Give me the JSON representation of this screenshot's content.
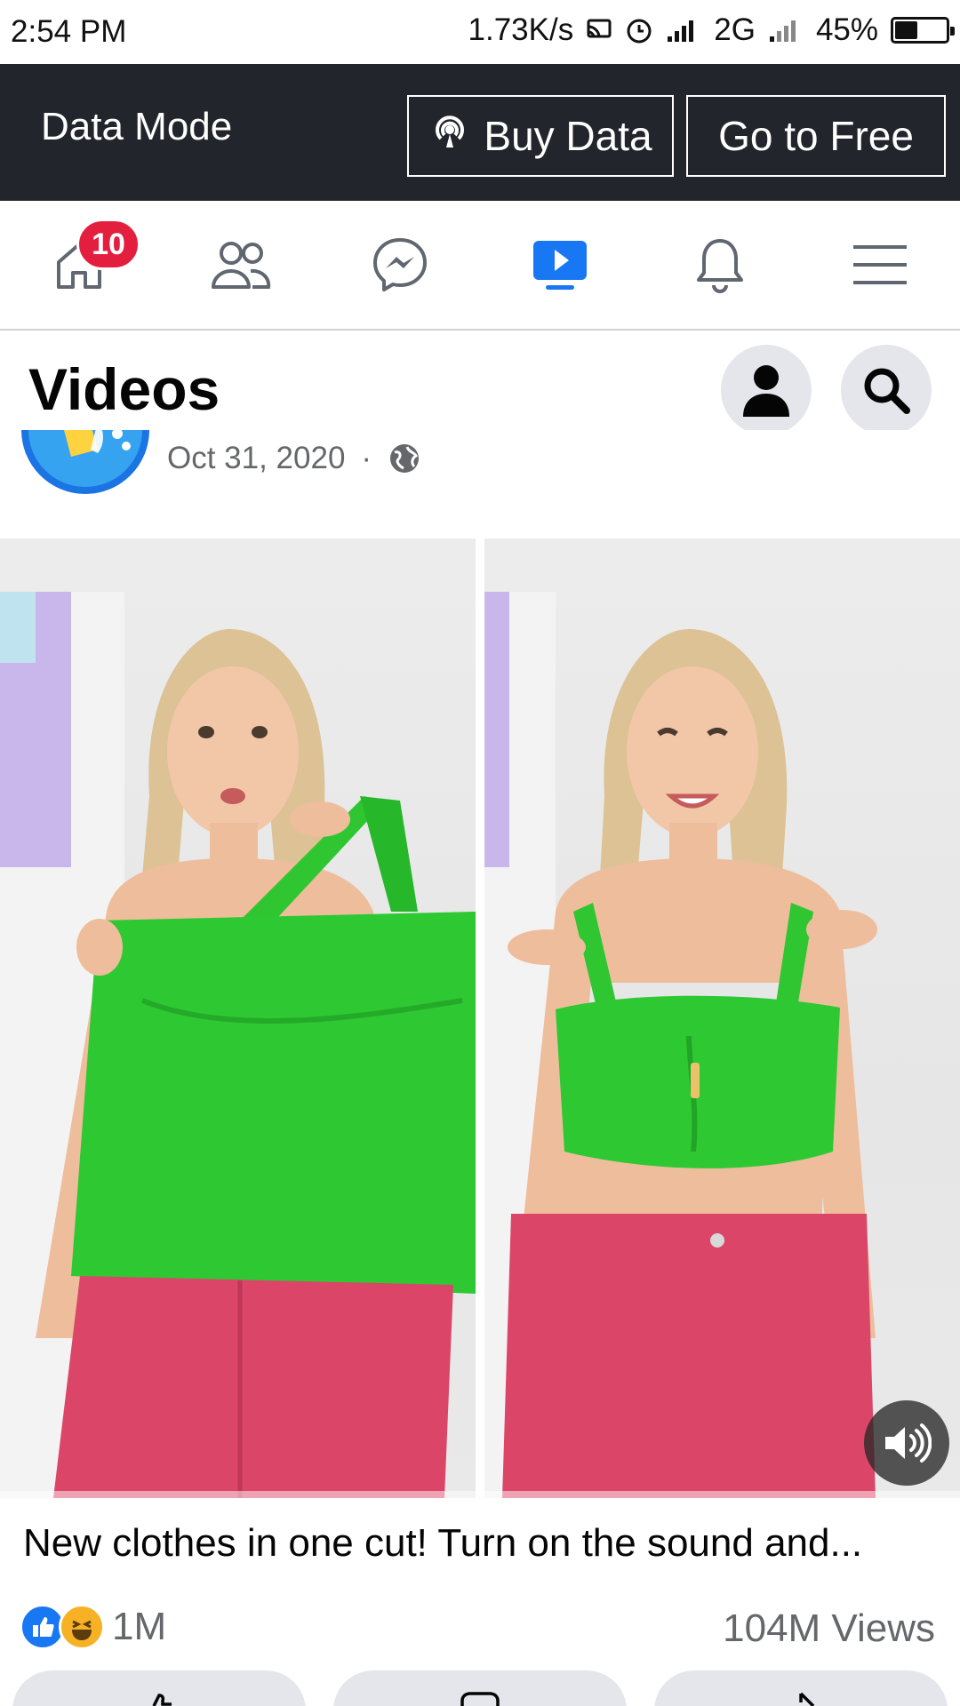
{
  "status_bar": {
    "time": "2:54 PM",
    "network_speed": "1.73K/s",
    "network_type": "2G",
    "battery": "45%",
    "battery_level": 0.45
  },
  "data_mode": {
    "label": "Data Mode",
    "buy_data": "Buy Data",
    "go_to_free": "Go to Free"
  },
  "nav": {
    "home_badge": "10",
    "active_tab": "videos",
    "active_color": "#1877f2"
  },
  "header": {
    "title": "Videos"
  },
  "post": {
    "date": "Oct 31, 2020",
    "separator": "·",
    "caption": "New clothes in one cut! Turn on the sound and...",
    "reaction_count": "1M",
    "views": "104M Views",
    "video_progress": 0.0
  },
  "colors": {
    "data_bar": "#23252c",
    "badge": "#e41e3f",
    "like": "#1877f2"
  }
}
